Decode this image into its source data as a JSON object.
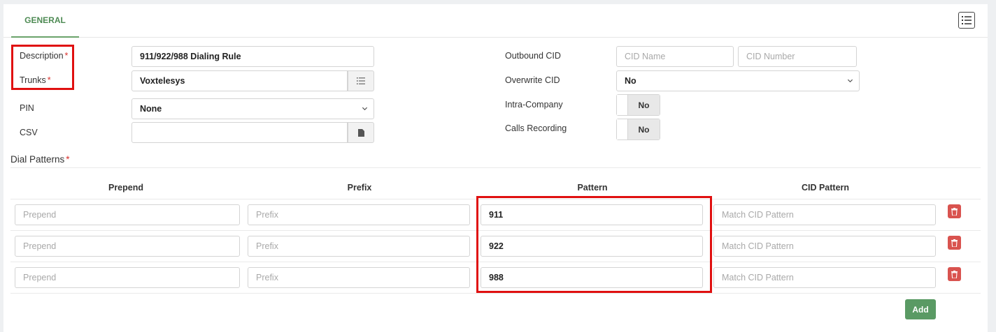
{
  "tabs": [
    {
      "label": "GENERAL"
    }
  ],
  "form": {
    "description": {
      "label": "Description",
      "required": "*",
      "value": "911/922/988 Dialing Rule"
    },
    "trunks": {
      "label": "Trunks",
      "required": "*",
      "value": "Voxtelesys"
    },
    "pin": {
      "label": "PIN",
      "value": "None"
    },
    "csv": {
      "label": "CSV",
      "value": ""
    },
    "outbound_cid": {
      "label": "Outbound CID",
      "name_placeholder": "CID Name",
      "number_placeholder": "CID Number"
    },
    "overwrite_cid": {
      "label": "Overwrite CID",
      "value": "No"
    },
    "intra_company": {
      "label": "Intra-Company",
      "value": "No"
    },
    "calls_recording": {
      "label": "Calls Recording",
      "value": "No"
    }
  },
  "dial_patterns": {
    "title": "Dial Patterns",
    "required": "*",
    "headers": [
      "Prepend",
      "Prefix",
      "Pattern",
      "CID Pattern"
    ],
    "placeholders": {
      "prepend": "Prepend",
      "prefix": "Prefix",
      "cid": "Match CID Pattern"
    },
    "rows": [
      {
        "prepend": "",
        "prefix": "",
        "pattern": "911",
        "cid": ""
      },
      {
        "prepend": "",
        "prefix": "",
        "pattern": "922",
        "cid": ""
      },
      {
        "prepend": "",
        "prefix": "",
        "pattern": "988",
        "cid": ""
      }
    ],
    "add_label": "Add"
  },
  "icons": {
    "menu": "list-icon",
    "trunks_addon": "list-icon",
    "csv_addon": "file-icon",
    "row_delete": "trash-icon"
  },
  "colors": {
    "accent": "#5a9a64",
    "danger": "#d9534f",
    "highlight": "#e01010"
  }
}
